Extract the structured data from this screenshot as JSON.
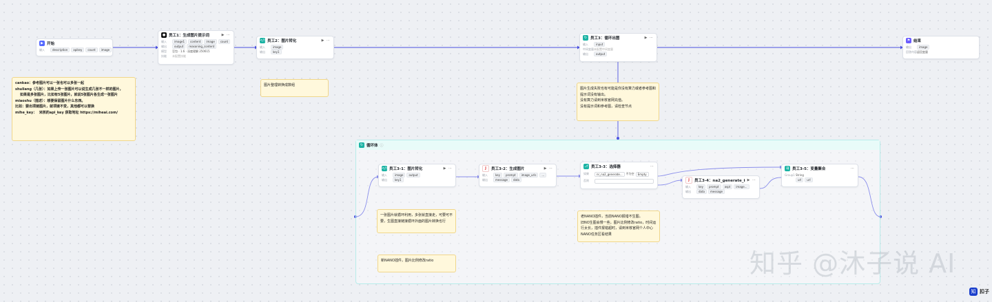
{
  "nodes": {
    "start": {
      "title": "开始",
      "inputs_label": "输入",
      "inputs": [
        "description",
        "apikey",
        "count",
        "image"
      ]
    },
    "emp1": {
      "title": "员工1：生成图片提示词",
      "in_label": "输入",
      "in": [
        "image1",
        "content",
        "image",
        "count"
      ],
      "out_label": "输出",
      "out": [
        "output",
        "reasoning_content"
      ],
      "model_label": "模型",
      "model": "豆包 · 1.6 · 深度理解 250615",
      "skill_label": "技能",
      "skill": "未配置技能"
    },
    "emp2": {
      "title": "员工2：图片转化",
      "in_label": "输入",
      "in": [
        "image"
      ],
      "out_label": "输出",
      "out": [
        "key1"
      ]
    },
    "emp3": {
      "title": "员工3：循环出图",
      "in_label": "输入",
      "in": [
        "input"
      ],
      "mid_label": "中间变量",
      "mid": "未配置中间变量",
      "out_label": "输出",
      "out": [
        "output"
      ]
    },
    "end": {
      "title": "结束",
      "in_label": "输出",
      "in": [
        "image"
      ],
      "ret_label": "回答内容",
      "ret": "返回变量"
    },
    "loop": {
      "title": "循环体"
    },
    "emp31": {
      "title": "员工3-1：图片转化",
      "in_label": "输入",
      "in": [
        "image",
        "output"
      ],
      "out_label": "输出",
      "out": [
        "key1"
      ]
    },
    "emp32": {
      "title": "员工3-2：生成图片",
      "in_label": "输入",
      "in": [
        "key",
        "prompt",
        "image_urls",
        "..."
      ],
      "out_label": "输出",
      "out": [
        "message",
        "data"
      ]
    },
    "emp33": {
      "title": "员工3-3：选择器",
      "if_label": "如果",
      "cond_var": "nr_na2_generate...",
      "cond_op": "不为空",
      "cond_val": "Empty",
      "else_label": "否则"
    },
    "emp34": {
      "title": "员工3-4：na2_generate_im...",
      "in_label": "输入",
      "in": [
        "key",
        "prompt",
        "aspt",
        "image..."
      ],
      "out_label": "输出",
      "out": [
        "data",
        "message"
      ]
    },
    "emp35": {
      "title": "员工3-5：变量聚合",
      "group_label": "Group1",
      "group_type": "String",
      "vars": [
        "url",
        "url"
      ]
    }
  },
  "notes": {
    "n1": [
      "cankao：参考图片可以一张也可以多张一起",
      "shuliang（几张）：如果上传一张图片可以说生成几张不一样的图片，",
      "    如果是多张图片，比如有5张图片，就说5张图片各生成一张图片",
      "miaoshu（描述）：想要保留图片什么东西。",
      "比如：要出项链图片，就项链不变，其他都可以替换",
      "mihe_key：  米核的api_key 获取地址 https://miheai.com/"
    ],
    "n2": [
      "图片整理转换成数组"
    ],
    "n3": [
      "图片生成失败也有可能是你没有算力或者参考图和提示词没有输出。",
      "没有算力请到米核官网充值。",
      "没有提示词和参考图，请检查节点"
    ],
    "n4": [
      "一张图片就循环利用，多张就直接走，可要可不要，生图直接链接循环外面的图片转换也行"
    ],
    "n5": [
      "老NANO插件，当前NANO报错不生图。",
      "旧NO生图会慢一些，图片比例修改ratio，时间运行太长，插件报错超时，请到米核官网个人中心NANO任务区看结果"
    ],
    "n6": [
      "新NANO插件，图片比例修改ratio"
    ]
  },
  "icons": {
    "start": "play-icon",
    "emp1": "black-model-icon",
    "emp2": "code-icon",
    "emp3": "loop-icon",
    "end": "flag-icon",
    "loop": "loop-icon",
    "emp31": "code-icon",
    "emp32": "plugin-icon",
    "emp33": "selector-icon",
    "emp34": "plugin-icon",
    "emp35": "aggregate-icon"
  },
  "colors": {
    "accent": "#4b51e0",
    "note_bg": "#fff8dc",
    "loop_border": "#b7ecea"
  },
  "watermark": "知乎 @沐子说 AI",
  "brand": {
    "logo": "知",
    "name": "扣子"
  }
}
